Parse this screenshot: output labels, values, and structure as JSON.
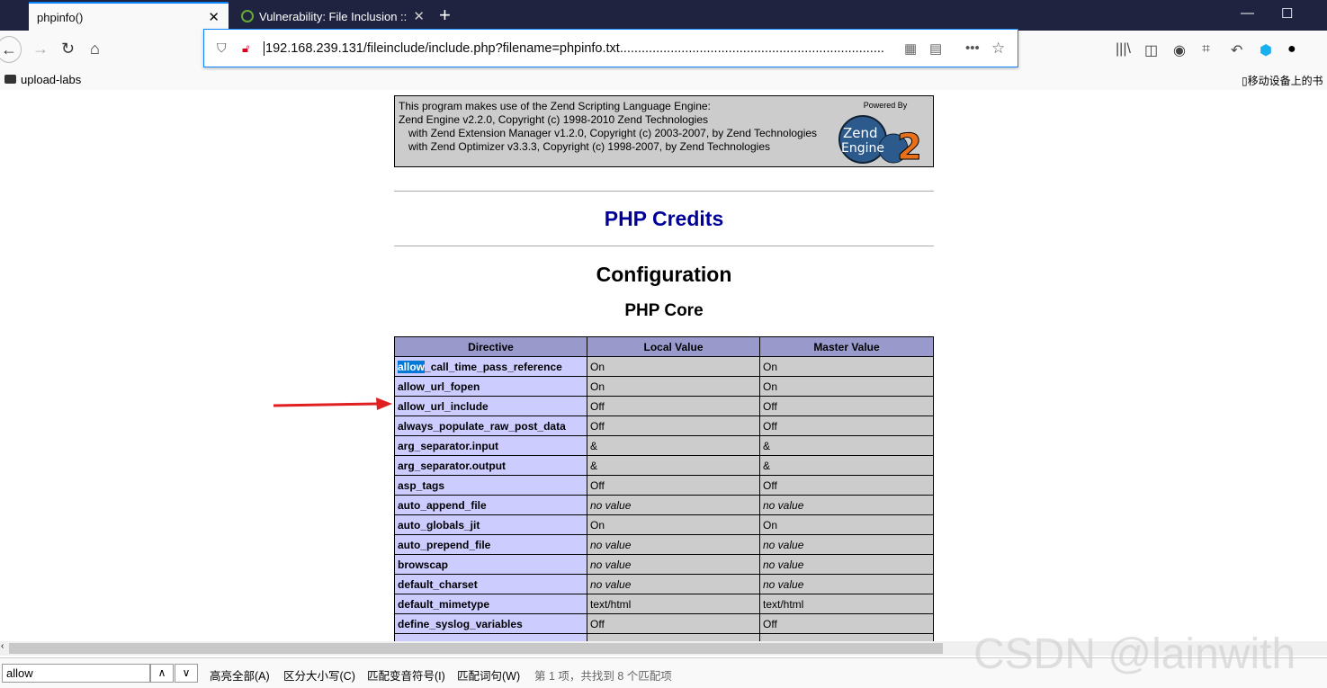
{
  "browser": {
    "tabs": [
      {
        "title": "phpinfo()",
        "active": true
      },
      {
        "title": "Vulnerability: File Inclusion ::",
        "active": false
      }
    ],
    "url": "192.168.239.131/fileinclude/include.php?filename=phpinfo.txt.........................................................................",
    "bookmarks": [
      {
        "label": "upload-labs"
      }
    ],
    "mobile_bookmarks": "移动设备上的书",
    "accent": "#0a84ff"
  },
  "page": {
    "zend": {
      "lines": [
        "This program makes use of the Zend Scripting Language Engine:",
        "Zend Engine v2.2.0, Copyright (c) 1998-2010 Zend Technologies",
        "with Zend Extension Manager v1.2.0, Copyright (c) 2003-2007, by Zend Technologies",
        "with Zend Optimizer v3.3.3, Copyright (c) 1998-2007, by Zend Technologies"
      ],
      "powered_by": "Powered By",
      "logo_text": "Zend Engine 2"
    },
    "credits": "PHP Credits",
    "configuration": "Configuration",
    "section": "PHP Core",
    "table": {
      "headers": [
        "Directive",
        "Local Value",
        "Master Value"
      ],
      "rows": [
        [
          "allow_call_time_pass_reference",
          "On",
          "On"
        ],
        [
          "allow_url_fopen",
          "On",
          "On"
        ],
        [
          "allow_url_include",
          "Off",
          "Off"
        ],
        [
          "always_populate_raw_post_data",
          "Off",
          "Off"
        ],
        [
          "arg_separator.input",
          "&",
          "&"
        ],
        [
          "arg_separator.output",
          "&",
          "&"
        ],
        [
          "asp_tags",
          "Off",
          "Off"
        ],
        [
          "auto_append_file",
          "no value",
          "no value"
        ],
        [
          "auto_globals_jit",
          "On",
          "On"
        ],
        [
          "auto_prepend_file",
          "no value",
          "no value"
        ],
        [
          "browscap",
          "no value",
          "no value"
        ],
        [
          "default_charset",
          "no value",
          "no value"
        ],
        [
          "default_mimetype",
          "text/html",
          "text/html"
        ],
        [
          "define_syslog_variables",
          "Off",
          "Off"
        ]
      ]
    }
  },
  "findbar": {
    "query": "allow",
    "highlight_all": "高亮全部(A)",
    "match_case": "区分大小写(C)",
    "match_diacritics": "匹配变音符号(I)",
    "whole_words": "匹配词句(W)",
    "status": "第 1 项，共找到 8 个匹配项"
  },
  "watermark": "CSDN @lainwith"
}
